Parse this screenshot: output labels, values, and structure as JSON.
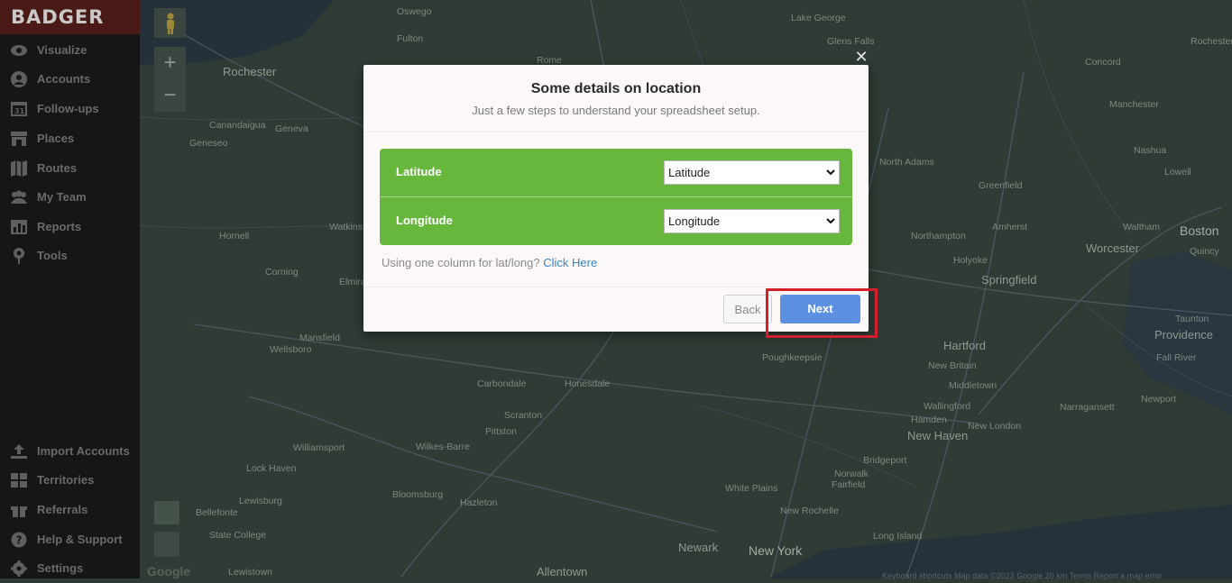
{
  "app": {
    "logo": "BADGER"
  },
  "sidebar": {
    "items": [
      {
        "label": "Visualize",
        "icon": "eye-icon"
      },
      {
        "label": "Accounts",
        "icon": "user-icon"
      },
      {
        "label": "Follow-ups",
        "icon": "calendar-icon"
      },
      {
        "label": "Places",
        "icon": "store-icon"
      },
      {
        "label": "Routes",
        "icon": "map-icon"
      },
      {
        "label": "My Team",
        "icon": "team-icon"
      },
      {
        "label": "Reports",
        "icon": "chart-icon"
      },
      {
        "label": "Tools",
        "icon": "pin-icon"
      }
    ],
    "bottom_items": [
      {
        "label": "Import Accounts",
        "icon": "upload-icon"
      },
      {
        "label": "Territories",
        "icon": "grid-icon"
      },
      {
        "label": "Referrals",
        "icon": "gift-icon"
      },
      {
        "label": "Help & Support",
        "icon": "help-icon"
      },
      {
        "label": "Settings",
        "icon": "gear-icon"
      }
    ]
  },
  "map": {
    "google": "Google",
    "attribution": "Keyboard shortcuts   Map data ©2023 Google   20 km   Terms   Report a map error",
    "labels": [
      "Oswego",
      "Lake George",
      "Fulton",
      "Glens Falls",
      "Rochester",
      "Rome",
      "Concord",
      "Rochester",
      "Canandaigua",
      "Geneva",
      "Manchester",
      "Geneseo",
      "Nashua",
      "Lowell",
      "North Adams",
      "Greenfield",
      "Amherst",
      "Northampton",
      "Worcester",
      "Waltham",
      "Boston",
      "Quincy",
      "Hornell",
      "Holyoke",
      "Springfield",
      "Corning",
      "Elmira",
      "Taunton",
      "Mansfield",
      "Wellsboro",
      "Hartford",
      "Providence",
      "Fall River",
      "Poughkeepsie",
      "New Britain",
      "Middletown",
      "Carbondale",
      "Honesdale",
      "Newport",
      "Wallingford",
      "Narragansett",
      "Scranton",
      "Hamden",
      "New London",
      "Pittston",
      "New Haven",
      "Williamsport",
      "Wilkes-Barre",
      "Bridgeport",
      "Lock Haven",
      "Norwalk",
      "Fairfield",
      "Lewisburg",
      "Bloomsburg",
      "White Plains",
      "Hazleton",
      "New Rochelle",
      "Bellefonte",
      "State College",
      "Long Island",
      "Newark",
      "New York",
      "Lewistown",
      "Allentown",
      "Watkins"
    ]
  },
  "modal": {
    "title": "Some details on location",
    "subtitle": "Just a few steps to understand your spreadsheet setup.",
    "fields": [
      {
        "label": "Latitude",
        "selected": "Latitude"
      },
      {
        "label": "Longitude",
        "selected": "Longitude"
      }
    ],
    "hint_text": "Using one column for lat/long?",
    "hint_link": "Click Here",
    "back_label": "Back",
    "next_label": "Next",
    "close_glyph": "✕"
  },
  "colors": {
    "sidebar_bg": "#161616",
    "field_panel": "#67b73d",
    "next_button": "#5b91e0",
    "highlight": "#d21f2b"
  }
}
